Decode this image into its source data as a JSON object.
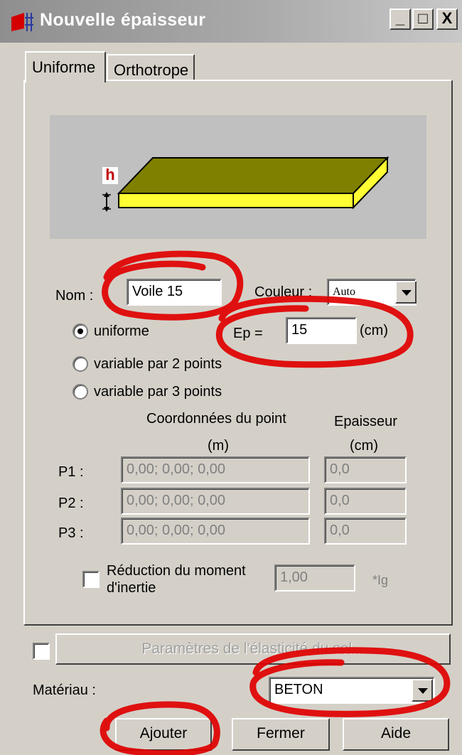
{
  "window": {
    "title": "Nouvelle épaisseur",
    "controls": [
      "_",
      "□",
      "X"
    ]
  },
  "tabs": [
    {
      "label": "Uniforme",
      "active": true
    },
    {
      "label": "Orthotrope",
      "active": false
    }
  ],
  "illustration": {
    "thickness_label": "h",
    "slab_top_color": "#808000",
    "slab_side_color": "#ffff33"
  },
  "form": {
    "nom_label": "Nom :",
    "nom_value": "Voile 15",
    "couleur_label": "Couleur :",
    "couleur_value": "Auto",
    "ep_label": "Ep =",
    "ep_value": "15",
    "ep_unit": "(cm)",
    "radios": [
      {
        "label": "uniforme",
        "checked": true
      },
      {
        "label": "variable par 2 points",
        "checked": false
      },
      {
        "label": "variable par 3 points",
        "checked": false
      }
    ],
    "coord_header": "Coordonnées du point",
    "coord_unit": "(m)",
    "ep_header": "Epaisseur",
    "ep_header_unit": "(cm)",
    "points": [
      {
        "label": "P1 :",
        "coords": "0,00; 0,00; 0,00",
        "thickness": "0,0"
      },
      {
        "label": "P2 :",
        "coords": "0,00; 0,00; 0,00",
        "thickness": "0,0"
      },
      {
        "label": "P3 :",
        "coords": "0,00; 0,00; 0,00",
        "thickness": "0,0"
      }
    ],
    "reduction_label_line1": "Réduction du moment",
    "reduction_label_line2": "d'inertie",
    "reduction_value": "1,00",
    "reduction_unit": "*Ig",
    "reduction_checked": false
  },
  "soil": {
    "checked": false,
    "button_label": "Paramètres de l'élasticité du sol..."
  },
  "materiau": {
    "label": "Matériau :",
    "value": "BETON"
  },
  "buttons": {
    "add": "Ajouter",
    "close": "Fermer",
    "help": "Aide"
  },
  "annotation_color": "#e00000"
}
